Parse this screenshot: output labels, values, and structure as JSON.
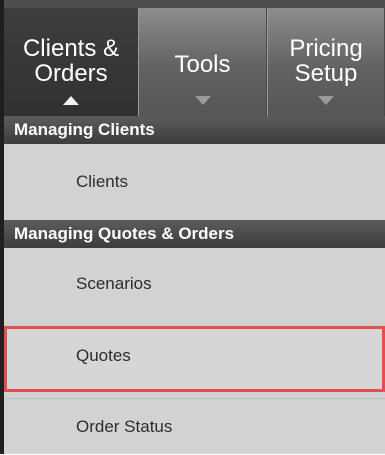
{
  "tabs": [
    {
      "label": "Clients &\nOrders",
      "active": true,
      "arrow": "up-arrow-icon"
    },
    {
      "label": "Tools",
      "active": false,
      "arrow": "down-arrow-icon"
    },
    {
      "label": "Pricing\nSetup",
      "active": false,
      "arrow": "down-arrow-icon"
    }
  ],
  "sections": {
    "managing_clients": {
      "title": "Managing Clients",
      "items": [
        "Clients"
      ]
    },
    "managing_quotes_orders": {
      "title": "Managing Quotes & Orders",
      "items": [
        "Scenarios",
        "Quotes",
        "Order Status"
      ]
    }
  },
  "highlighted_item": "Quotes",
  "colors": {
    "highlight_outline": "#e05050",
    "tab_bar": "#4e4e4e",
    "menu_background": "#d2d2d2",
    "section_header": "#4a4a4a"
  }
}
